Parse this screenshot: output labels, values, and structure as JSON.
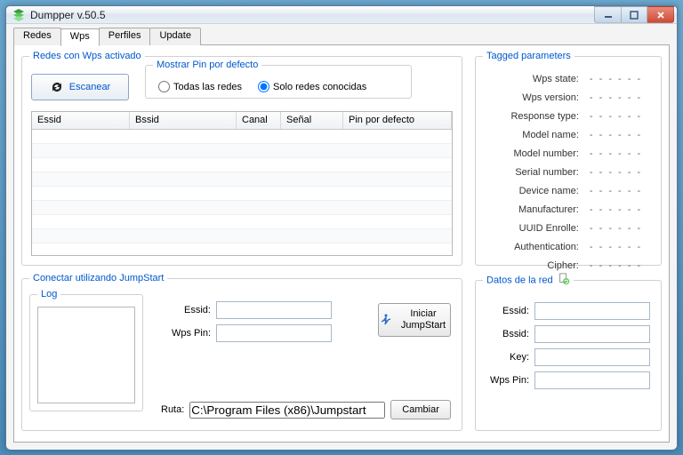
{
  "window": {
    "title": "Dumpper v.50.5"
  },
  "tabs": [
    "Redes",
    "Wps",
    "Perfiles",
    "Update"
  ],
  "active_tab": 1,
  "redes_group": {
    "title": "Redes con Wps activado",
    "scan_label": "Escanear",
    "mostrar_title": "Mostrar Pin por defecto",
    "radio_all": "Todas las redes",
    "radio_known": "Solo redes conocidas",
    "columns": {
      "essid": "Essid",
      "bssid": "Bssid",
      "canal": "Canal",
      "senal": "Señal",
      "pin": "Pin por defecto"
    }
  },
  "tagged": {
    "title": "Tagged parameters",
    "rows": [
      {
        "label": "Wps state:",
        "value": "- - - - - -"
      },
      {
        "label": "Wps version:",
        "value": "- - - - - -"
      },
      {
        "label": "Response type:",
        "value": "- - - - - -"
      },
      {
        "label": "Model name:",
        "value": "- - - - - -"
      },
      {
        "label": "Model number:",
        "value": "- - - - - -"
      },
      {
        "label": "Serial number:",
        "value": "- - - - - -"
      },
      {
        "label": "Device name:",
        "value": "- - - - - -"
      },
      {
        "label": "Manufacturer:",
        "value": "- - - - - -"
      },
      {
        "label": "UUID Enrolle:",
        "value": "- - - - - -"
      },
      {
        "label": "Authentication:",
        "value": "- - - - - -"
      },
      {
        "label": "Cipher:",
        "value": "- - - - - -"
      }
    ]
  },
  "jump": {
    "title": "Conectar utilizando JumpStart",
    "log_title": "Log",
    "essid_label": "Essid:",
    "essid_value": "",
    "wpspin_label": "Wps Pin:",
    "wpspin_value": "",
    "start_label": "Iniciar JumpStart",
    "ruta_label": "Ruta:",
    "ruta_value": "C:\\Program Files (x86)\\Jumpstart",
    "cambiar_label": "Cambiar"
  },
  "datos": {
    "title": "Datos de la red",
    "essid_label": "Essid:",
    "essid_value": "",
    "bssid_label": "Bssid:",
    "bssid_value": "",
    "key_label": "Key:",
    "key_value": "",
    "wpspin_label": "Wps Pin:",
    "wpspin_value": ""
  }
}
